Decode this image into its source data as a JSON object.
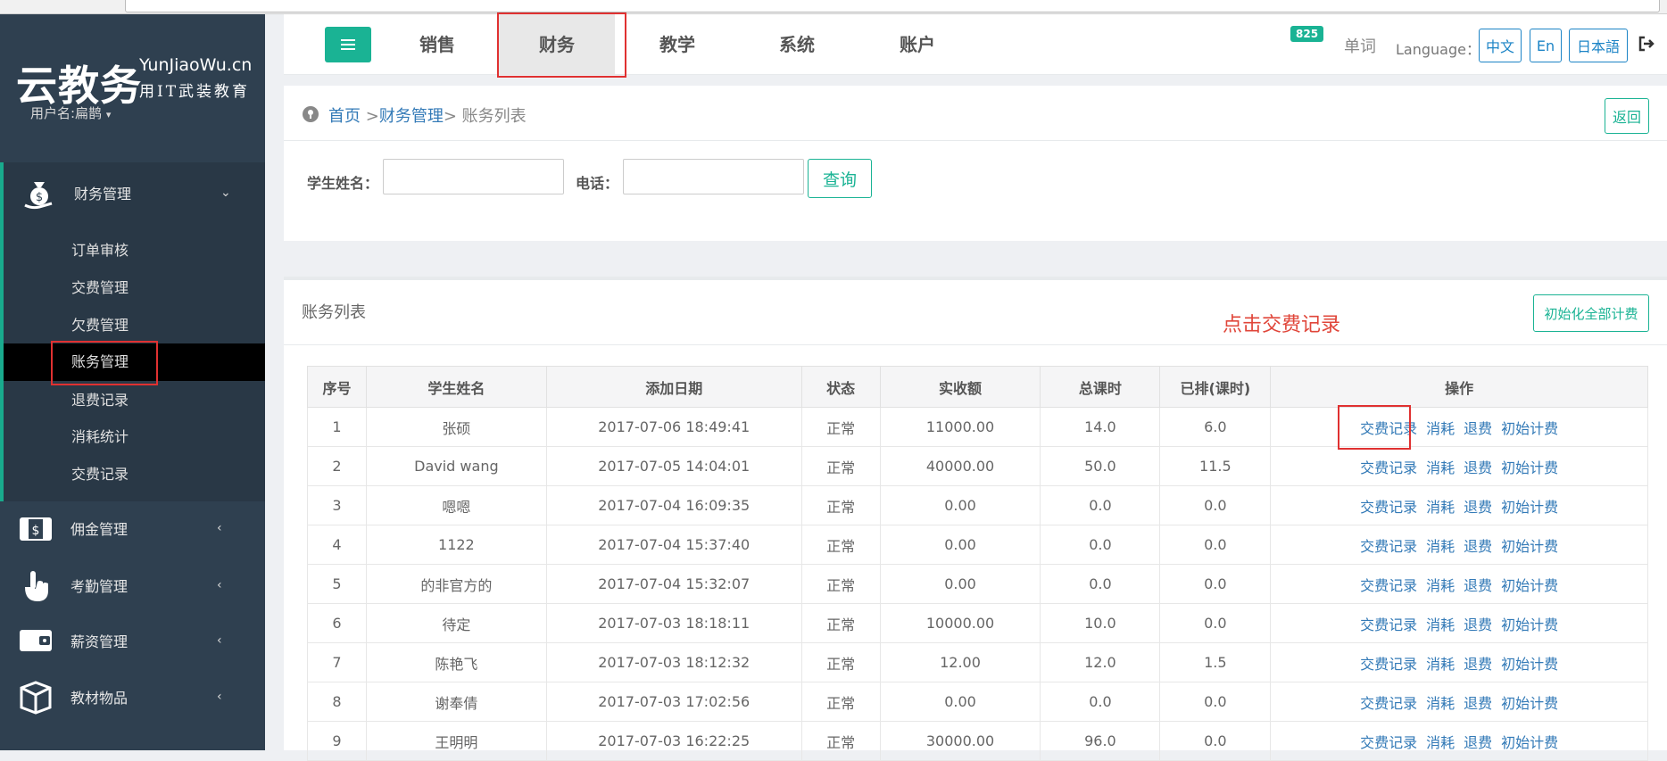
{
  "sidebar": {
    "logo_main": "云教务",
    "logo_en": "YunJiaoWu.cn",
    "logo_sub": "用IT武装教育",
    "username": "用户名:扁鹊",
    "groups": [
      {
        "label": "财务管理",
        "icon": "money-bag-icon"
      },
      {
        "label": "佣金管理",
        "icon": "wallet-cash-icon"
      },
      {
        "label": "考勤管理",
        "icon": "hand-touch-icon"
      },
      {
        "label": "薪资管理",
        "icon": "wallet-icon"
      },
      {
        "label": "教材物品",
        "icon": "box-icon"
      }
    ],
    "submenu": [
      "订单审核",
      "交费管理",
      "欠费管理",
      "账务管理",
      "退费记录",
      "消耗统计",
      "交费记录"
    ],
    "active_submenu": "账务管理"
  },
  "topnav": {
    "tabs": [
      "销售",
      "财务",
      "教学",
      "系统",
      "账户"
    ],
    "active_tab": "财务",
    "badge_count": "825",
    "words_label": "单词",
    "language_label": "Language：",
    "languages": [
      "中文",
      "En",
      "日本語"
    ]
  },
  "breadcrumb": {
    "home": "首页",
    "sep1": ">",
    "section": "财务管理",
    "current": "> 账务列表",
    "back_label": "返回"
  },
  "search": {
    "name_label": "学生姓名：",
    "name_value": "",
    "phone_label": "电话：",
    "phone_value": "",
    "query_label": "查询"
  },
  "list": {
    "title": "账务列表",
    "hint": "点击交费记录",
    "init_all_label": "初始化全部计费",
    "columns": [
      "序号",
      "学生姓名",
      "添加日期",
      "状态",
      "实收额",
      "总课时",
      "已排(课时)",
      "操作"
    ],
    "actions": [
      "交费记录",
      "消耗",
      "退费",
      "初始计费"
    ],
    "rows": [
      [
        "1",
        "张硕",
        "2017-07-06 18:49:41",
        "正常",
        "11000.00",
        "14.0",
        "6.0"
      ],
      [
        "2",
        "David wang",
        "2017-07-05 14:04:01",
        "正常",
        "40000.00",
        "50.0",
        "11.5"
      ],
      [
        "3",
        "嗯嗯",
        "2017-07-04 16:09:35",
        "正常",
        "0.00",
        "0.0",
        "0.0"
      ],
      [
        "4",
        "1122",
        "2017-07-04 15:37:40",
        "正常",
        "0.00",
        "0.0",
        "0.0"
      ],
      [
        "5",
        "的非官方的",
        "2017-07-04 15:32:07",
        "正常",
        "0.00",
        "0.0",
        "0.0"
      ],
      [
        "6",
        "待定",
        "2017-07-03 18:18:11",
        "正常",
        "10000.00",
        "10.0",
        "0.0"
      ],
      [
        "7",
        "陈艳飞",
        "2017-07-03 18:12:32",
        "正常",
        "12.00",
        "12.0",
        "1.5"
      ],
      [
        "8",
        "谢奉倩",
        "2017-07-03 17:02:56",
        "正常",
        "0.00",
        "0.0",
        "0.0"
      ],
      [
        "9",
        "王明明",
        "2017-07-03 16:22:25",
        "正常",
        "30000.00",
        "96.0",
        "0.0"
      ]
    ]
  },
  "colors": {
    "sidebar_bg": "#2f4050",
    "accent_green": "#1ab394",
    "link_blue": "#337ab7",
    "highlight_red": "#e03131"
  }
}
